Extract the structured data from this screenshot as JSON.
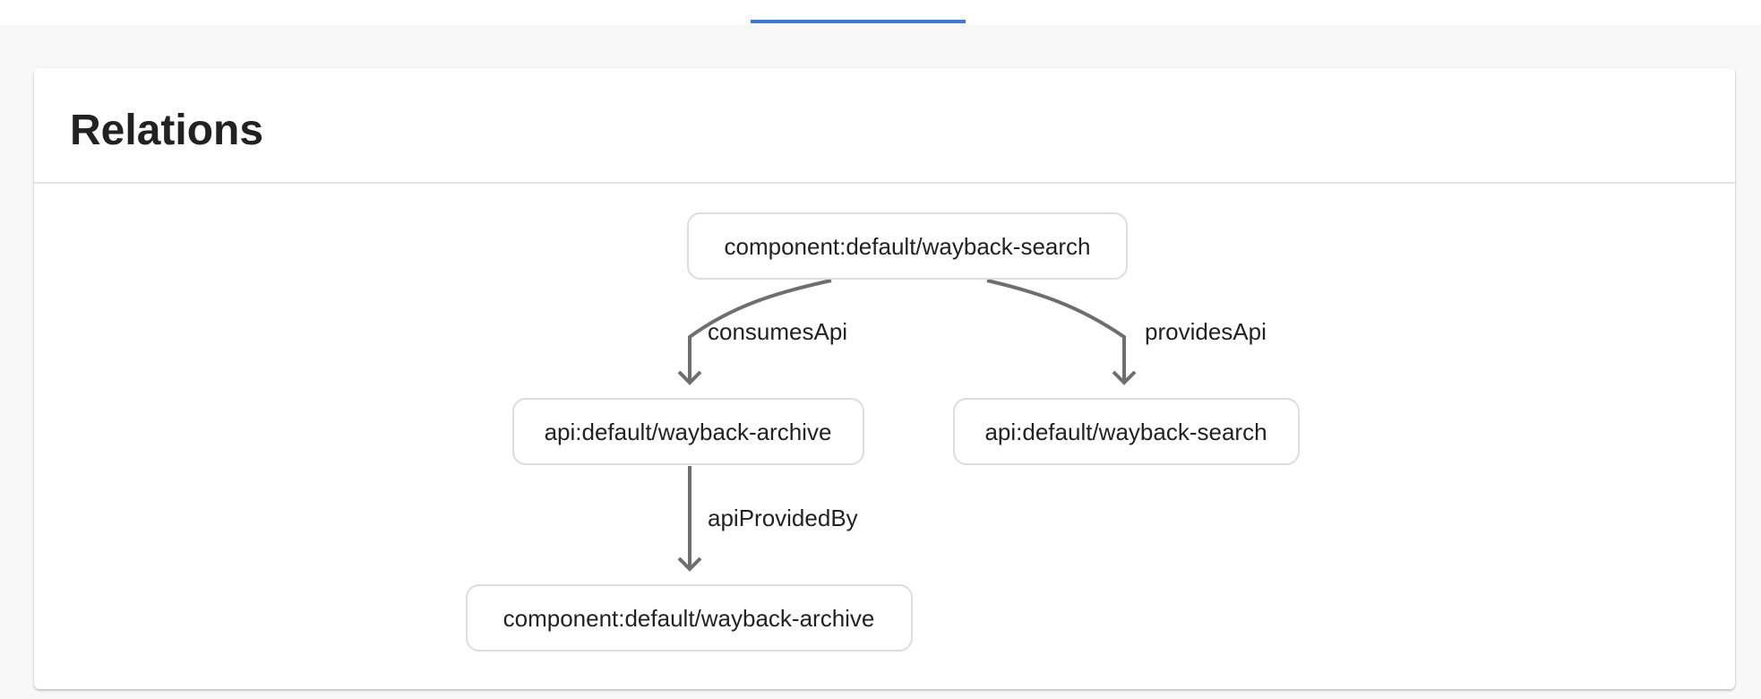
{
  "page": {
    "card_title": "Relations"
  },
  "graph": {
    "nodes": {
      "root": "component:default/wayback-search",
      "api_archive": "api:default/wayback-archive",
      "api_search": "api:default/wayback-search",
      "component_archive": "component:default/wayback-archive"
    },
    "edges": {
      "consumes": "consumesApi",
      "provides": "providesApi",
      "provided_by": "apiProvidedBy"
    }
  },
  "colors": {
    "accent": "#3b78d8",
    "edge": "#6e6e6e",
    "node_border": "#dddddd",
    "background": "#f8f8f8"
  }
}
